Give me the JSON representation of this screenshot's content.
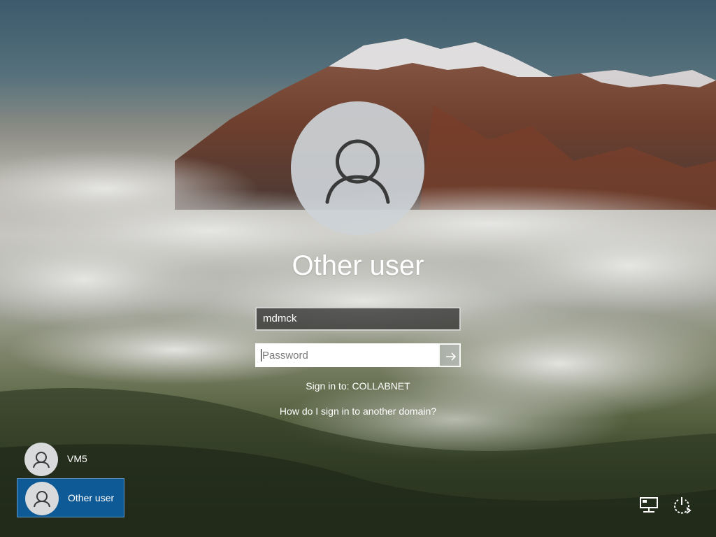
{
  "login": {
    "display_name": "Other user",
    "username_value": "mdmck",
    "password_placeholder": "Password",
    "signin_to_text": "Sign in to: COLLABNET",
    "domain_help_link": "How do I sign in to another domain?"
  },
  "user_list": [
    {
      "name": "VM5",
      "selected": false
    },
    {
      "name": "Other user",
      "selected": true
    }
  ],
  "icons": {
    "avatar": "person-icon",
    "submit": "arrow-right-icon",
    "network": "network-icon",
    "power": "power-icon"
  },
  "colors": {
    "selected_user_bg": "#0e5a96",
    "field_border": "#e6e6e6",
    "text": "#ffffff"
  }
}
